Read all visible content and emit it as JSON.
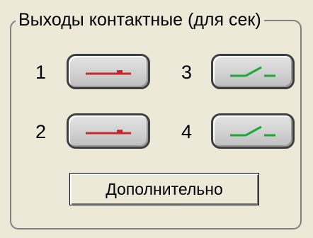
{
  "group": {
    "title": "Выходы контактные (для сек)"
  },
  "outputs": [
    {
      "number": "1",
      "state": "closed",
      "icon": "contact-closed-icon",
      "color": "#c8282d"
    },
    {
      "number": "2",
      "state": "closed",
      "icon": "contact-closed-icon",
      "color": "#c8282d"
    },
    {
      "number": "3",
      "state": "open",
      "icon": "contact-open-icon",
      "color": "#1fa83a"
    },
    {
      "number": "4",
      "state": "open",
      "icon": "contact-open-icon",
      "color": "#1fa83a"
    }
  ],
  "extra_button": {
    "label": "Дополнительно"
  }
}
